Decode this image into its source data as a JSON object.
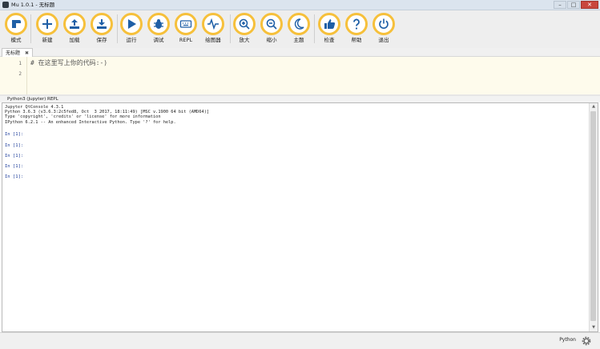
{
  "window": {
    "title": "Mu 1.0.1 - 无标题"
  },
  "toolbar": {
    "buttons": [
      {
        "label": "模式",
        "icon": "mode-icon"
      },
      {
        "label": "新建",
        "icon": "plus-icon"
      },
      {
        "label": "加载",
        "icon": "upload-icon"
      },
      {
        "label": "保存",
        "icon": "download-icon"
      },
      {
        "label": "运行",
        "icon": "play-icon"
      },
      {
        "label": "调试",
        "icon": "bug-icon"
      },
      {
        "label": "REPL",
        "icon": "keyboard-icon"
      },
      {
        "label": "绘图器",
        "icon": "pulse-icon"
      },
      {
        "label": "放大",
        "icon": "zoom-in-icon"
      },
      {
        "label": "缩小",
        "icon": "zoom-out-icon"
      },
      {
        "label": "主题",
        "icon": "moon-icon"
      },
      {
        "label": "检查",
        "icon": "thumbs-up-icon"
      },
      {
        "label": "帮助",
        "icon": "question-icon"
      },
      {
        "label": "退出",
        "icon": "power-icon"
      }
    ]
  },
  "tabs": [
    {
      "label": "无标题",
      "close": "✖"
    }
  ],
  "editor": {
    "line_numbers": [
      "1",
      "2"
    ],
    "code": "# 在这里写上你的代码:-)"
  },
  "panel_tabs": [
    "Python3 (Jupyter) REPL"
  ],
  "repl": {
    "banner": "Jupyter QtConsole 4.3.1\nPython 3.6.3 (v3.6.3:2c5fed8, Oct  3 2017, 18:11:49) [MSC v.1900 64 bit (AMD64)]\nType 'copyright', 'credits' or 'license' for more information\nIPython 6.2.1 -- An enhanced Interactive Python. Type '?' for help.",
    "prompts": [
      "In [1]:",
      "In [1]:",
      "In [1]:",
      "In [1]:",
      "In [1]:"
    ]
  },
  "status": {
    "mode": "Python"
  },
  "colors": {
    "accent": "#f6c03b",
    "icon_blue": "#1f5fa6",
    "editor_bg": "#fefbec"
  }
}
